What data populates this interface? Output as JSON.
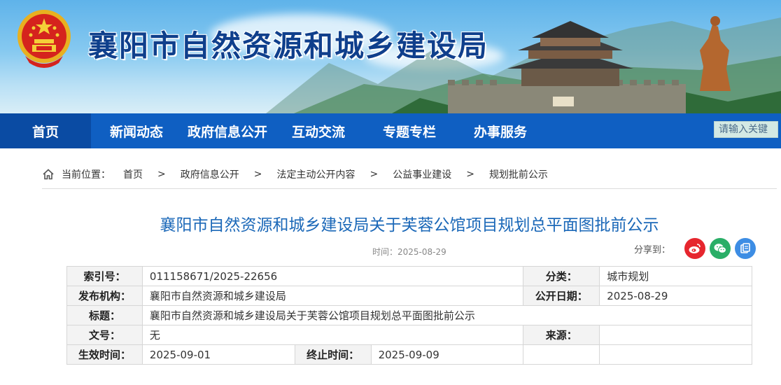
{
  "header": {
    "site_name": "襄阳市自然资源和城乡建设局"
  },
  "nav": {
    "items": [
      "首页",
      "新闻动态",
      "政府信息公开",
      "互动交流",
      "专题专栏",
      "办事服务"
    ],
    "search_placeholder": "请输入关键"
  },
  "breadcrumb": {
    "label": "当前位置：",
    "items": [
      "首页",
      "政府信息公开",
      "法定主动公开内容",
      "公益事业建设",
      "规划批前公示"
    ],
    "separator": ">"
  },
  "article": {
    "title": "襄阳市自然资源和城乡建设局关于芙蓉公馆项目规划总平面图批前公示",
    "time_label": "时间：",
    "time_value": "2025-08-29",
    "share_label": "分享到："
  },
  "info_table": {
    "index_label": "索引号：",
    "index_value": "011158671/2025-22656",
    "category_label": "分类：",
    "category_value": "城市规划",
    "publisher_label": "发布机构：",
    "publisher_value": "襄阳市自然资源和城乡建设局",
    "pubdate_label": "公开日期：",
    "pubdate_value": "2025-08-29",
    "subject_label": "标题：",
    "subject_value": "襄阳市自然资源和城乡建设局关于芙蓉公馆项目规划总平面图批前公示",
    "docno_label": "文号：",
    "docno_value": "无",
    "source_label": "来源：",
    "source_value": "",
    "effective_label": "生效时间：",
    "effective_value": "2025-09-01",
    "expire_label": "终止时间：",
    "expire_value": "2025-09-09"
  },
  "colors": {
    "nav_bg": "#0f5fc2",
    "nav_active": "#0a4ba3",
    "title": "#1b68b8",
    "weibo": "#e6262e",
    "wechat": "#2aae67",
    "other": "#3d8de4"
  }
}
